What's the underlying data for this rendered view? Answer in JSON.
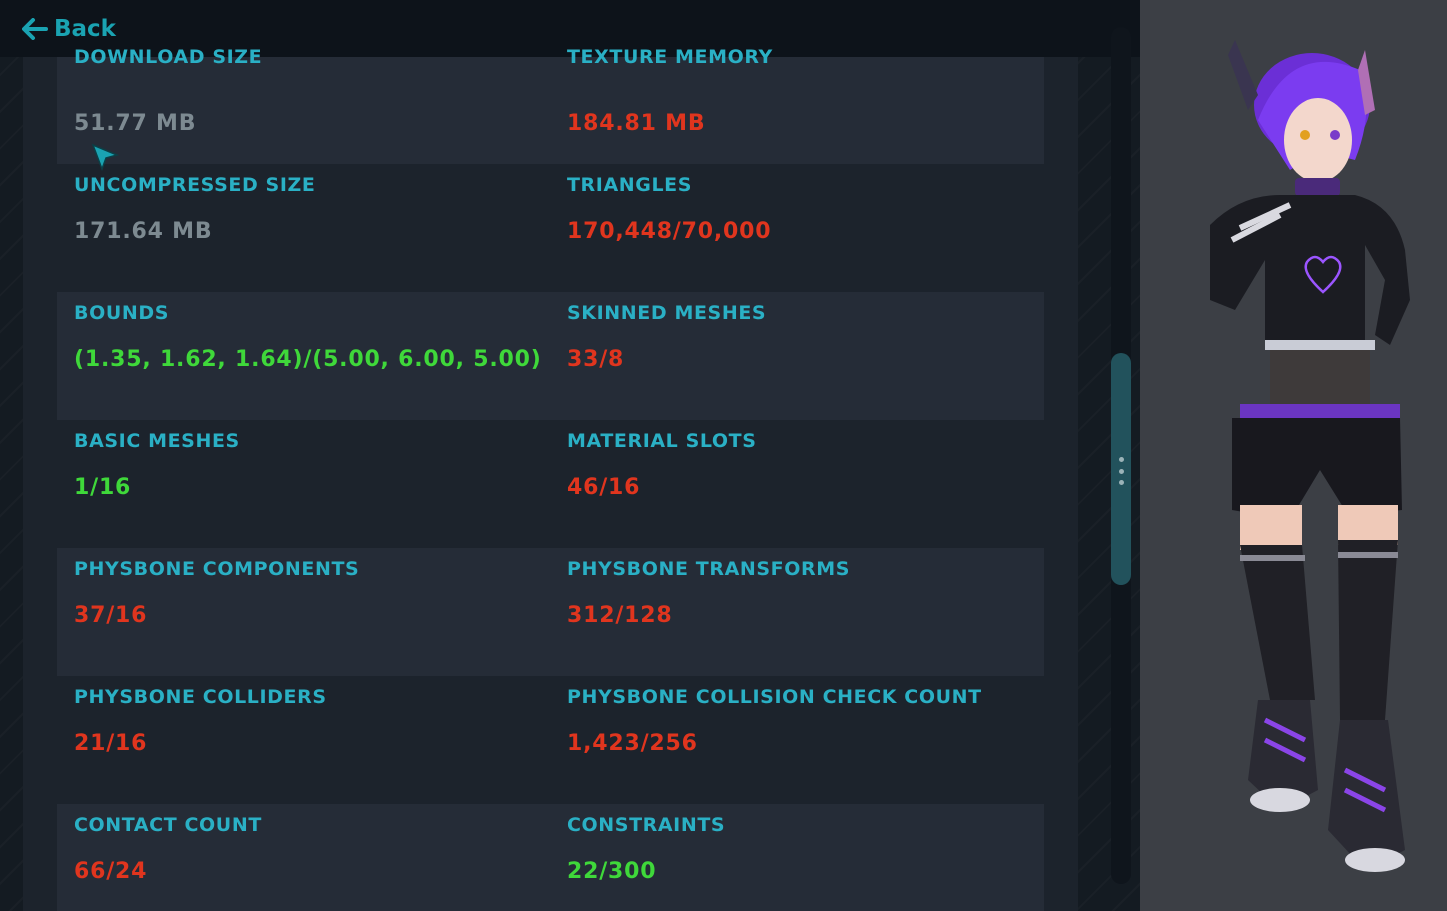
{
  "header": {
    "back_label": "Back"
  },
  "stats": [
    {
      "left": {
        "label": "DOWNLOAD SIZE",
        "value": "51.77 MB",
        "status": "neutral"
      },
      "right": {
        "label": "TEXTURE MEMORY",
        "value": "184.81 MB",
        "status": "bad"
      }
    },
    {
      "left": {
        "label": "UNCOMPRESSED SIZE",
        "value": "171.64 MB",
        "status": "neutral"
      },
      "right": {
        "label": "TRIANGLES",
        "value": "170,448/70,000",
        "status": "bad"
      }
    },
    {
      "left": {
        "label": "BOUNDS",
        "value": "(1.35, 1.62, 1.64)/(5.00, 6.00, 5.00)",
        "status": "good"
      },
      "right": {
        "label": "SKINNED MESHES",
        "value": "33/8",
        "status": "bad"
      }
    },
    {
      "left": {
        "label": "BASIC MESHES",
        "value": "1/16",
        "status": "good"
      },
      "right": {
        "label": "MATERIAL SLOTS",
        "value": "46/16",
        "status": "bad"
      }
    },
    {
      "left": {
        "label": "PHYSBONE COMPONENTS",
        "value": "37/16",
        "status": "bad"
      },
      "right": {
        "label": "PHYSBONE TRANSFORMS",
        "value": "312/128",
        "status": "bad"
      }
    },
    {
      "left": {
        "label": "PHYSBONE COLLIDERS",
        "value": "21/16",
        "status": "bad"
      },
      "right": {
        "label": "PHYSBONE COLLISION CHECK COUNT",
        "value": "1,423/256",
        "status": "bad"
      }
    },
    {
      "left": {
        "label": "CONTACT COUNT",
        "value": "66/24",
        "status": "bad"
      },
      "right": {
        "label": "CONSTRAINTS",
        "value": "22/300",
        "status": "good"
      }
    }
  ],
  "colors": {
    "accent": "#2ab0c5",
    "neutral": "#7d8a91",
    "bad": "#e0351e",
    "good": "#3fd83a"
  },
  "icons": {
    "back": "arrow-left-icon",
    "cursor": "pointer-cursor-icon",
    "grip": "vertical-dots-icon"
  }
}
